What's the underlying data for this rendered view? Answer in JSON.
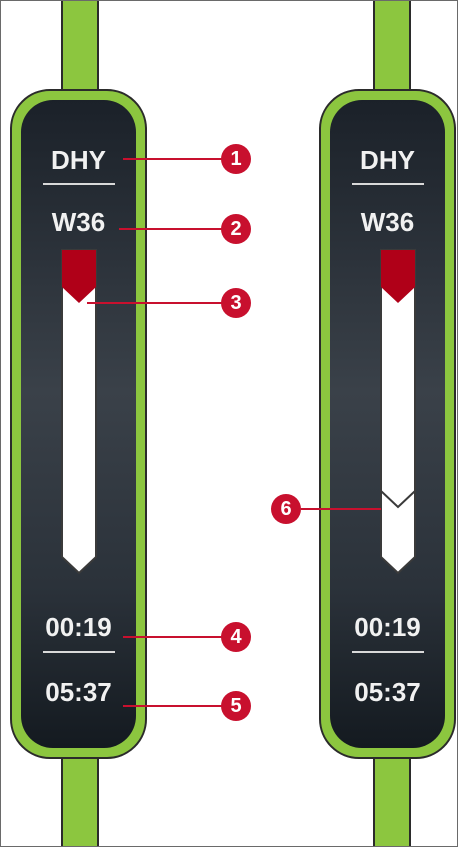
{
  "station_left": {
    "reagent": "DHY",
    "station": "W36",
    "elapsed": "00:19",
    "total": "05:37"
  },
  "station_right": {
    "reagent": "DHY",
    "station": "W36",
    "elapsed": "00:19",
    "total": "05:37"
  },
  "callouts": [
    "1",
    "2",
    "3",
    "4",
    "5",
    "6"
  ],
  "colors": {
    "frame_green": "#8cc63f",
    "panel_dark": "#2b323a",
    "callout_red": "#c8102e",
    "gauge_red": "#b00018",
    "gauge_fill": "#ffffff"
  }
}
